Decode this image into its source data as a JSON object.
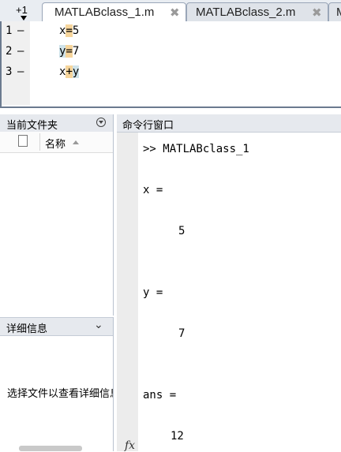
{
  "editor": {
    "plus_label": "+1",
    "tabs": [
      {
        "label": "MATLABclass_1.m",
        "active": true
      },
      {
        "label": "MATLABclass_2.m",
        "active": false
      },
      {
        "label": "M",
        "active": false
      }
    ],
    "close_glyph": "✖",
    "lines": [
      {
        "number": "1",
        "marker": "—",
        "text": "x=5"
      },
      {
        "number": "2",
        "marker": "—",
        "text": "y=7"
      },
      {
        "number": "3",
        "marker": "—",
        "text": "x+y"
      }
    ]
  },
  "folder": {
    "title": "当前文件夹",
    "name_column": "名称"
  },
  "details": {
    "title": "详细信息",
    "chevron": "⌄",
    "message": "选择文件以查看详细信息"
  },
  "command": {
    "title": "命令行窗口",
    "prompt_line": ">> MATLABclass_1",
    "outputs": [
      {
        "label": "x =",
        "value": "5"
      },
      {
        "label": "y =",
        "value": "7"
      },
      {
        "label": "ans =",
        "value": "12"
      }
    ],
    "fx_label": "fx"
  },
  "colors": {
    "var_highlight": "#cfe3ea",
    "op_highlight": "#f6d59c"
  }
}
